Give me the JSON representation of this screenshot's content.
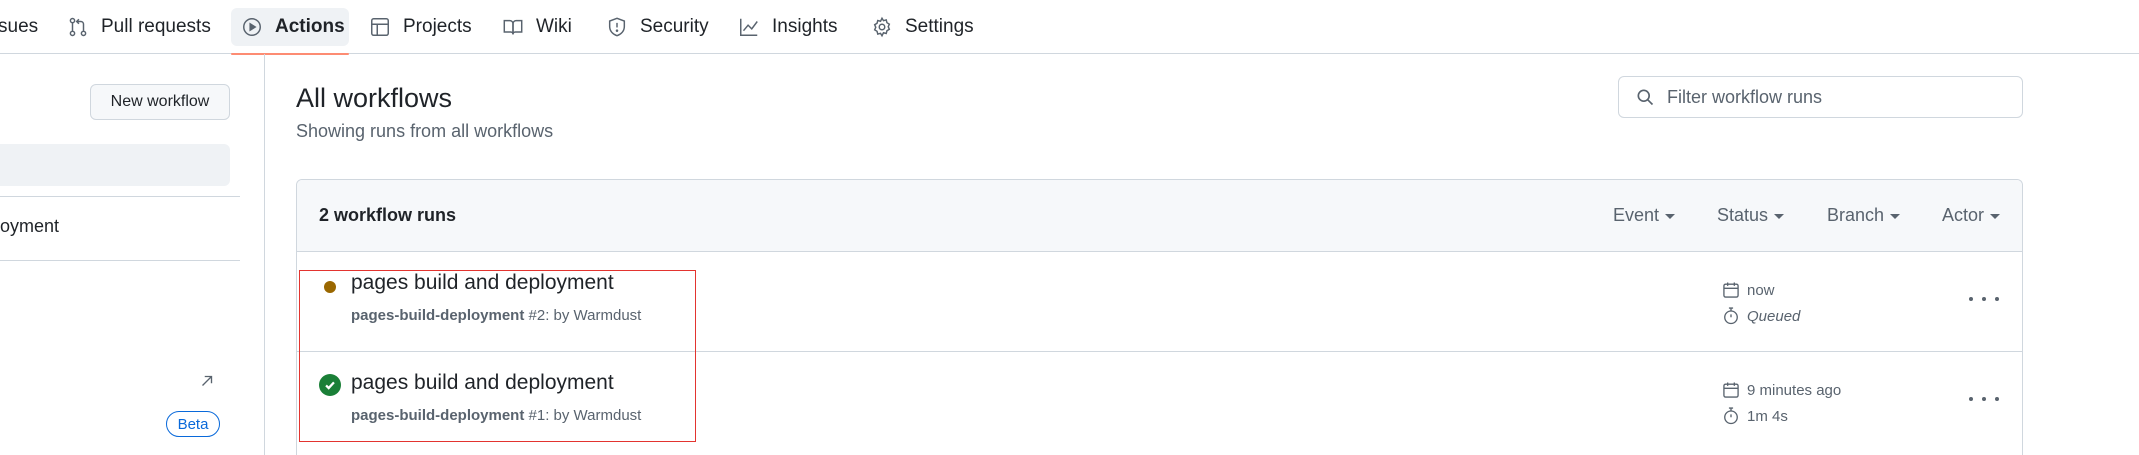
{
  "nav": {
    "tabs": [
      {
        "label": "Issues",
        "visible_label": "sues",
        "icon": "issue-icon"
      },
      {
        "label": "Pull requests",
        "icon": "git-pull-request-icon"
      },
      {
        "label": "Actions",
        "icon": "play-icon",
        "active": true
      },
      {
        "label": "Projects",
        "icon": "table-icon"
      },
      {
        "label": "Wiki",
        "icon": "book-icon"
      },
      {
        "label": "Security",
        "icon": "shield-icon"
      },
      {
        "label": "Insights",
        "icon": "graph-icon"
      },
      {
        "label": "Settings",
        "icon": "gear-icon"
      }
    ],
    "active_underline_color": "#fd8c73"
  },
  "sidebar": {
    "new_workflow_label": "New workflow",
    "workflow_item_visible": "oyment",
    "beta_label": "Beta"
  },
  "main": {
    "title": "All workflows",
    "subtitle": "Showing runs from all workflows",
    "filter_placeholder": "Filter workflow runs",
    "runs_count": "2 workflow runs",
    "filters": [
      "Event",
      "Status",
      "Branch",
      "Actor"
    ],
    "runs": [
      {
        "status": "queued",
        "status_color": "#9a6700",
        "title": "pages build and deployment",
        "workflow": "pages-build-deployment",
        "run_suffix": " #2: by Warmdust",
        "when": "now",
        "duration": "Queued"
      },
      {
        "status": "success",
        "status_color": "#1a7f37",
        "title": "pages build and deployment",
        "workflow": "pages-build-deployment",
        "run_suffix": " #1: by Warmdust",
        "when": "9 minutes ago",
        "duration": "1m 4s"
      }
    ]
  }
}
